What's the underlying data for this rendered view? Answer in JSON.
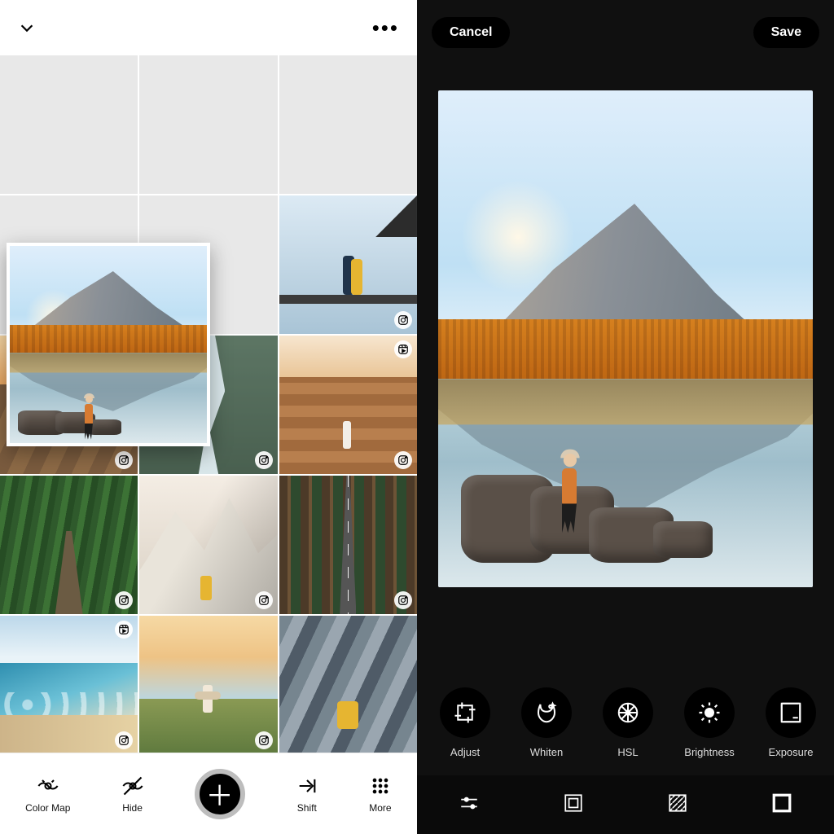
{
  "left": {
    "toolbar": {
      "color_map": "Color Map",
      "hide": "Hide",
      "shift": "Shift",
      "more": "More"
    },
    "grid_badges": {
      "instagram": "instagram",
      "reels": "reels"
    }
  },
  "right": {
    "cancel": "Cancel",
    "save": "Save",
    "tools": {
      "adjust": "Adjust",
      "whiten": "Whiten",
      "hsl": "HSL",
      "brightness": "Brightness",
      "exposure": "Exposure"
    }
  }
}
